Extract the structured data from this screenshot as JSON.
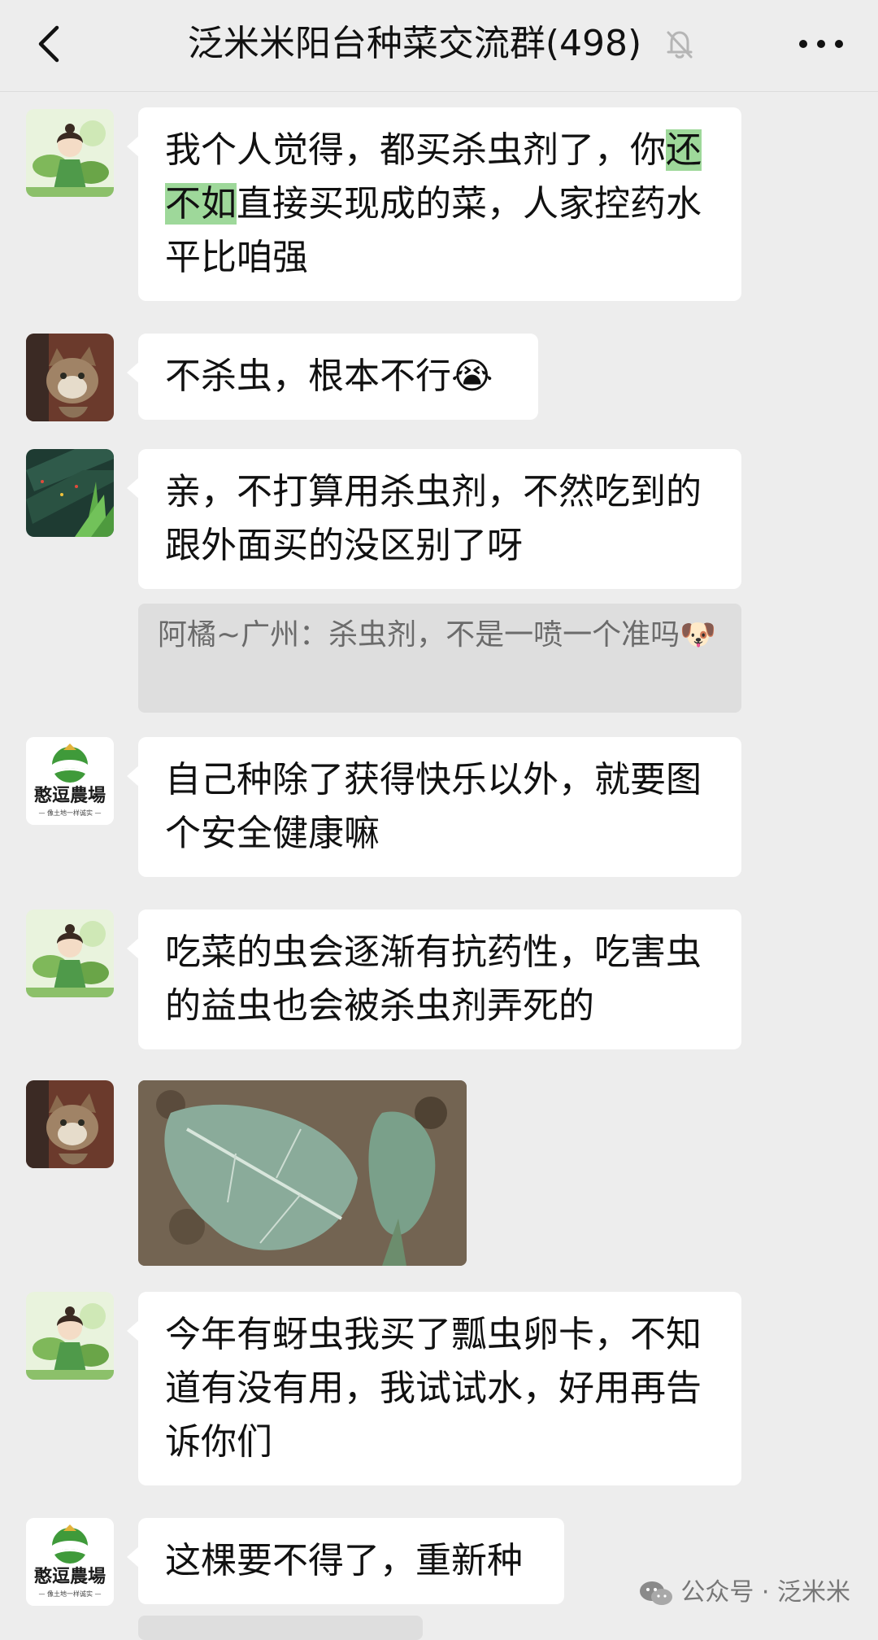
{
  "header": {
    "title": "泛米米阳台种菜交流群(498)"
  },
  "messages": [
    {
      "parts": [
        {
          "text": "我个人觉得，都买杀虫剂了，你"
        },
        {
          "text": "还不如",
          "highlight": true
        },
        {
          "text": "直接买现成的菜，人家控药水平比咱强"
        }
      ]
    },
    {
      "text": "不杀虫，根本不行😭"
    },
    {
      "text": "亲，不打算用杀虫剂，不然吃到的跟外面买的没区别了呀"
    },
    {
      "text": "自己种除了获得快乐以外，就要图个安全健康嘛"
    },
    {
      "text": "吃菜的虫会逐渐有抗药性，吃害虫的益虫也会被杀虫剂弄死的"
    },
    {
      "text": "今年有蚜虫我买了瓢虫卵卡，不知道有没有用，我试试水，好用再告诉你们"
    },
    {
      "text": "这棵要不得了，重新种"
    }
  ],
  "quote": {
    "text": "阿橘~广州：杀虫剂，不是一喷一个准吗🐶"
  },
  "farm_logo": {
    "name": "憨逗農場",
    "slogan": "— 像土地一样诚实 —"
  },
  "watermark": {
    "text": "公众号 · 泛米米"
  },
  "colors": {
    "background": "#ededed",
    "bubble": "#ffffff",
    "highlight": "#9ed89a",
    "quote_bg": "#dedede"
  }
}
